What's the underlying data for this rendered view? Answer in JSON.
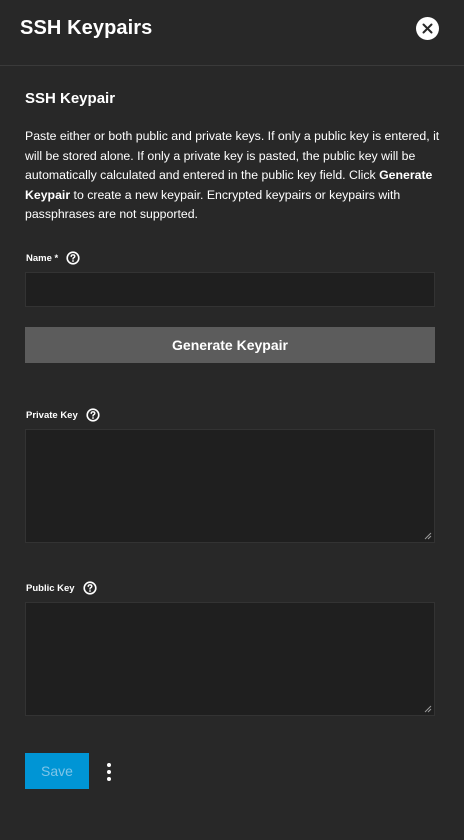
{
  "header": {
    "title": "SSH Keypairs",
    "close_icon": "close-icon"
  },
  "form": {
    "section_title": "SSH Keypair",
    "description_1": "Paste either or both public and private keys. If only a public key is entered, it will be stored alone. If only a private key is pasted, the public key will be automatically calculated and entered in the public key field. Click ",
    "description_bold": "Generate Keypair",
    "description_2": " to create a new keypair. Encrypted keypairs or keypairs with passphrases are not supported.",
    "name_label": "Name *",
    "name_value": "",
    "generate_label": "Generate Keypair",
    "private_key_label": "Private Key",
    "private_key_value": "",
    "public_key_label": "Public Key",
    "public_key_value": ""
  },
  "footer": {
    "save_label": "Save",
    "more_icon": "more-vert-icon"
  },
  "colors": {
    "background": "#282828",
    "input_bg": "#1f1f1f",
    "generate_button": "#5c5c5c",
    "save_button": "#0095d5",
    "save_text": "#7fc5e8"
  }
}
